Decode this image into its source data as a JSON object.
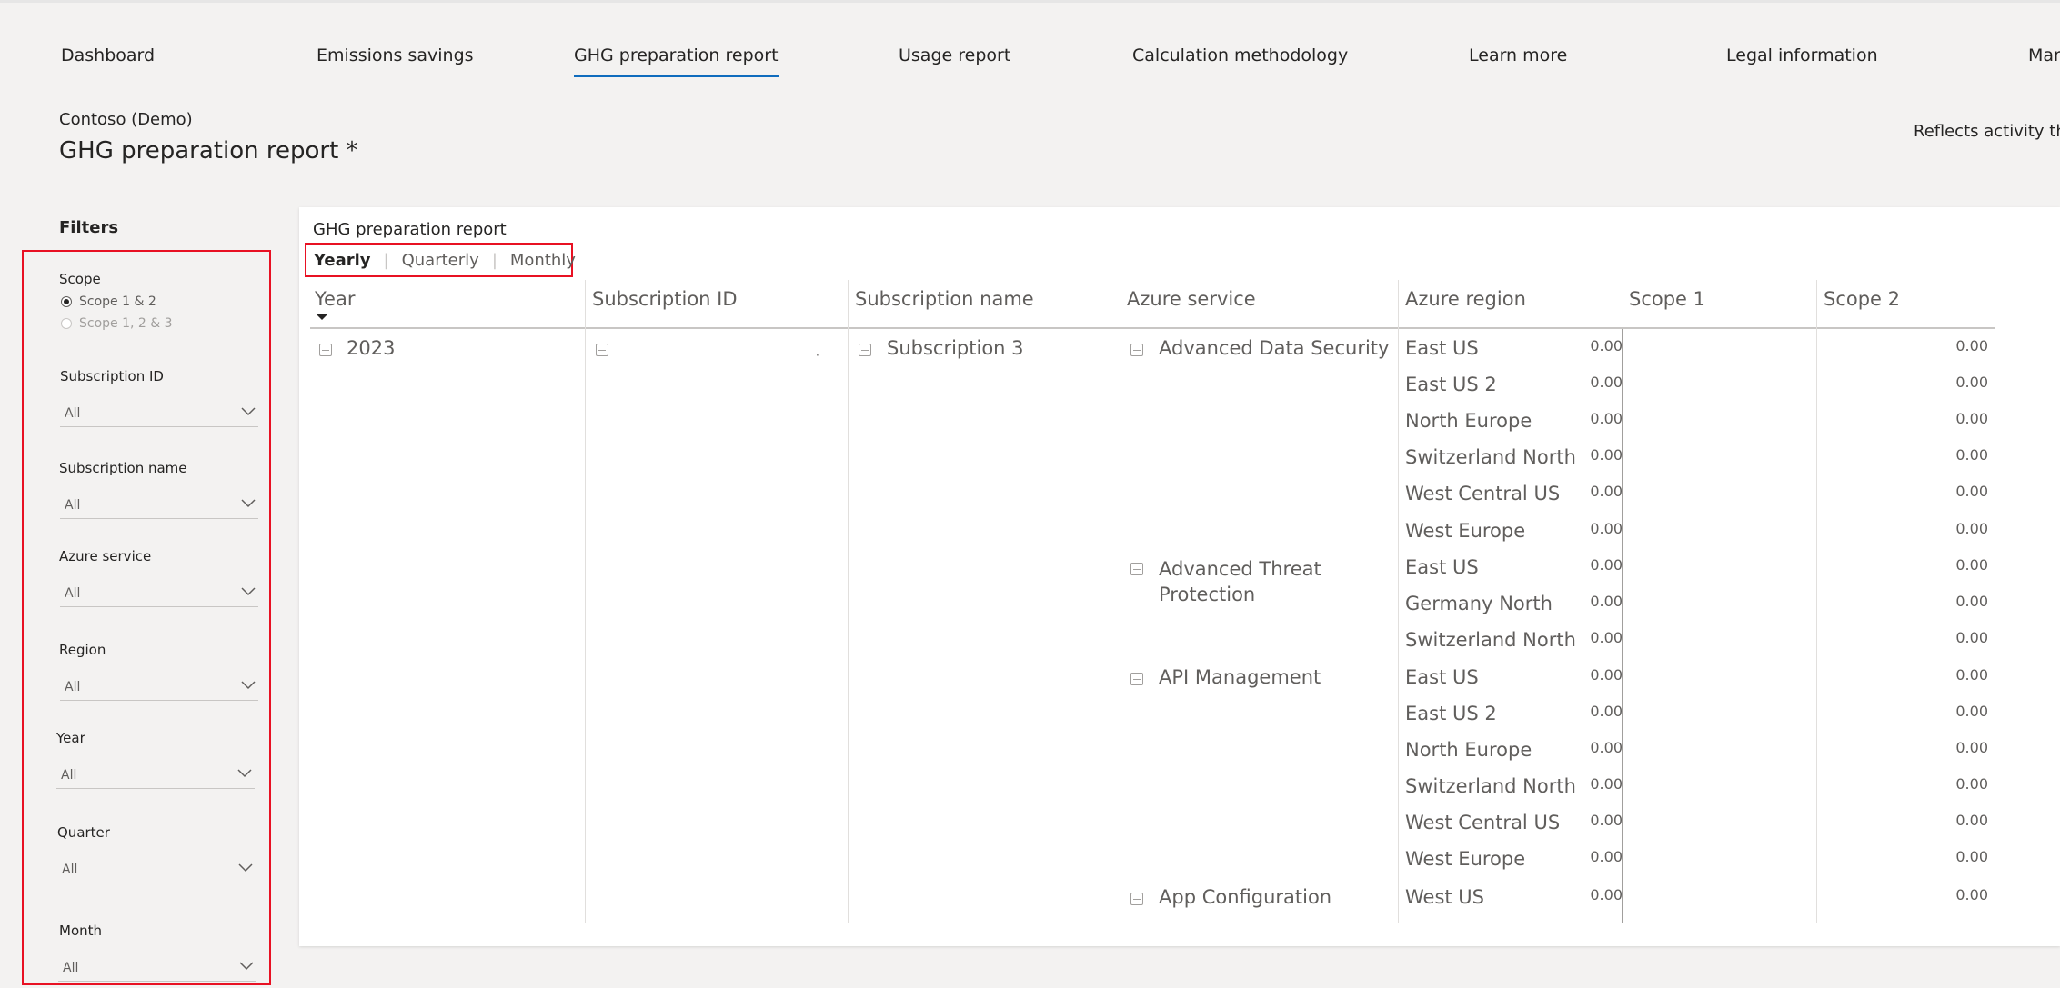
{
  "nav": {
    "items": [
      "Dashboard",
      "Emissions savings",
      "GHG preparation report",
      "Usage report",
      "Calculation methodology",
      "Learn more",
      "Legal information",
      "Man"
    ],
    "active_index": 2
  },
  "header": {
    "org": "Contoso (Demo)",
    "title": "GHG preparation report *",
    "reflects": "Reflects activity thro"
  },
  "filters": {
    "heading": "Filters",
    "scope": {
      "label": "Scope",
      "options": [
        "Scope 1 & 2",
        "Scope 1, 2 & 3"
      ],
      "selected_index": 0
    },
    "dropdowns": [
      {
        "label": "Subscription ID",
        "value": "All"
      },
      {
        "label": "Subscription name",
        "value": "All"
      },
      {
        "label": "Azure service",
        "value": "All"
      },
      {
        "label": "Region",
        "value": "All"
      },
      {
        "label": "Year",
        "value": "All"
      },
      {
        "label": "Quarter",
        "value": "All"
      },
      {
        "label": "Month",
        "value": "All"
      }
    ]
  },
  "report": {
    "title": "GHG preparation report",
    "periods": [
      "Yearly",
      "Quarterly",
      "Monthly"
    ],
    "active_period_index": 0,
    "separator": "|",
    "columns": [
      "Year",
      "Subscription ID",
      "Subscription name",
      "Azure service",
      "Azure region",
      "Scope 1",
      "Scope 2"
    ],
    "year": "2023",
    "subscription_id": "·",
    "subscription_name": "Subscription 3",
    "services": [
      {
        "name": "Advanced Data Security",
        "regions": [
          "East US",
          "East US 2",
          "North Europe",
          "Switzerland North",
          "West Central US",
          "West Europe"
        ]
      },
      {
        "name": "Advanced Threat Protection",
        "regions": [
          "East US",
          "Germany North",
          "Switzerland North"
        ]
      },
      {
        "name": "API Management",
        "regions": [
          "East US",
          "East US 2",
          "North Europe",
          "Switzerland North",
          "West Central US",
          "West Europe"
        ]
      },
      {
        "name": "App Configuration",
        "regions": [
          "West US"
        ]
      }
    ],
    "scope1_value": "0.00",
    "scope2_value": "0.00"
  },
  "colors": {
    "accent": "#0f6cbd",
    "highlight_border": "#e81123",
    "background": "#f3f2f1"
  }
}
